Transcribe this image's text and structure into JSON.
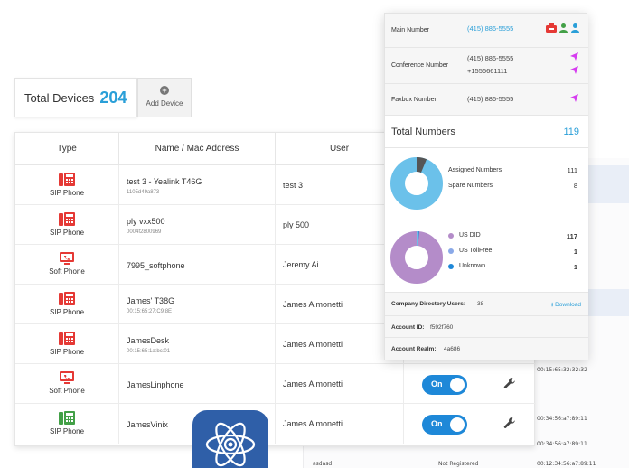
{
  "summary": {
    "total_devices_label": "Total Devices",
    "total_devices_count": "204",
    "add_device_label": "Add Device"
  },
  "table": {
    "headers": {
      "type": "Type",
      "name": "Name / Mac Address",
      "user": "User"
    },
    "rows": [
      {
        "type": "SIP Phone",
        "icon": "sip-phone-icon",
        "icon_color": "#e53935",
        "name": "test 3 - Yealink T46G",
        "mac": "1105d49a873",
        "user": "test 3"
      },
      {
        "type": "SIP Phone",
        "icon": "sip-phone-icon",
        "icon_color": "#e53935",
        "name": "ply vxx500",
        "mac": "0004f2800969",
        "user": "ply 500"
      },
      {
        "type": "Soft Phone",
        "icon": "soft-phone-icon",
        "icon_color": "#e53935",
        "name": "7995_softphone",
        "mac": "",
        "user": "Jeremy Ai"
      },
      {
        "type": "SIP Phone",
        "icon": "sip-phone-icon",
        "icon_color": "#e53935",
        "name": "James' T38G",
        "mac": "00:15:65:27:C9:8E",
        "user": "James Aimonetti"
      },
      {
        "type": "SIP Phone",
        "icon": "sip-phone-icon",
        "icon_color": "#e53935",
        "name": "JamesDesk",
        "mac": "00:15:65:1a:bc:01",
        "user": "James Aimonetti"
      },
      {
        "type": "Soft Phone",
        "icon": "soft-phone-icon",
        "icon_color": "#e53935",
        "name": "JamesLinphone",
        "mac": "",
        "user": "James Aimonetti",
        "toggle": "On"
      },
      {
        "type": "SIP Phone",
        "icon": "sip-phone-icon",
        "icon_color": "#43a047",
        "name": "JamesVinix",
        "mac": "",
        "user": "James Aimonetti",
        "toggle": "On"
      }
    ]
  },
  "numbers": {
    "main_label": "Main Number",
    "main_number": "(415) 886-5555",
    "conference_label": "Conference Number",
    "conference_number_1": "(415) 886-5555",
    "conference_number_2": "+1556661111",
    "faxbox_label": "Faxbox Number",
    "faxbox_number": "(415) 886-5555",
    "total_label": "Total Numbers",
    "total_value": "119",
    "assigned_label": "Assigned Numbers",
    "assigned_value": "111",
    "spare_label": "Spare Numbers",
    "spare_value": "8",
    "us_did_label": "US DID",
    "us_did_value": "117",
    "us_tollfree_label": "US TollFree",
    "us_tollfree_value": "1",
    "unknown_label": "Unknown",
    "unknown_value": "1",
    "directory_label": "Company Directory Users:",
    "directory_value": "38",
    "download_label": "Download",
    "account_id_label": "Account ID:",
    "account_id_value": "f592f760",
    "account_realm_label": "Account Realm:",
    "account_realm_value": "4a686"
  },
  "background": {
    "row1_time": "00:15:65:32:32:32",
    "row2_time": "00:34:56:a7:89:11",
    "row3_time": "00:34:56:a7:89:11",
    "row4_name": "asdasd",
    "row4_status": "Not Registered",
    "row4_time": "00:12:34:56:a7:89:11"
  },
  "colors": {
    "accent": "#2a9fd8",
    "toggle": "#1e88d8",
    "donut_blue": "#6bc1ea",
    "donut_purple": "#b48cc9",
    "app_icon": "#2f5fa8"
  }
}
